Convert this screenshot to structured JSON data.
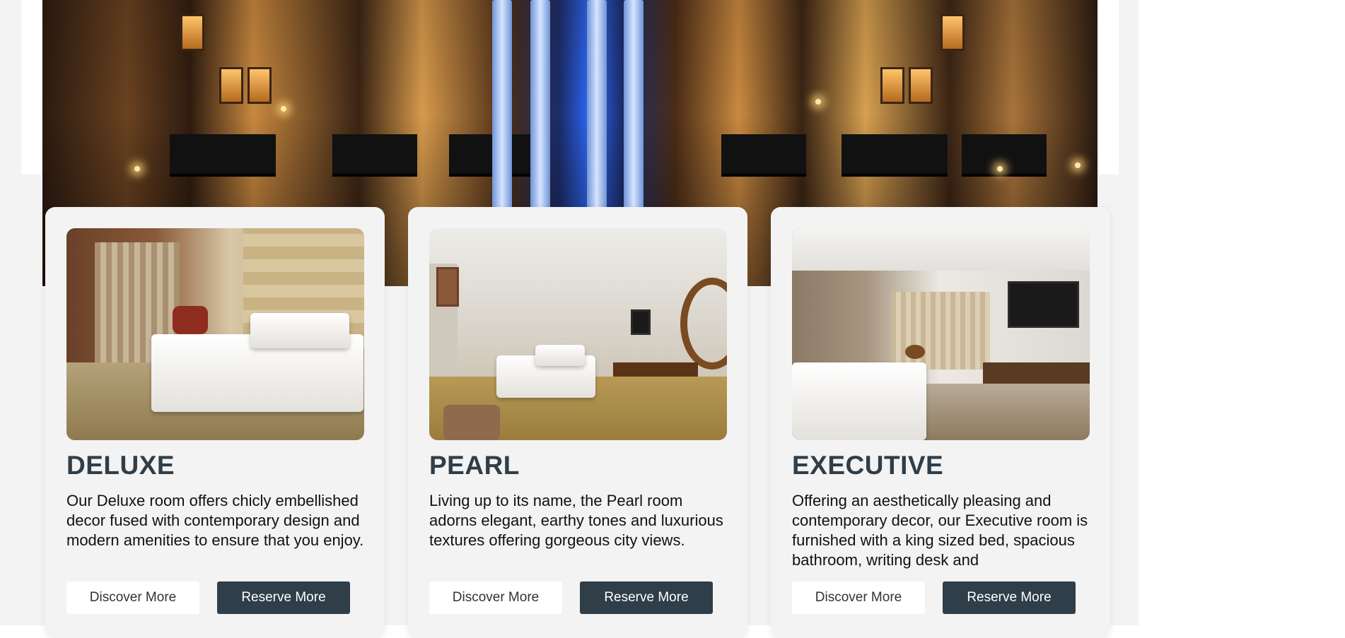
{
  "colors": {
    "page_background": "#f3f3f3",
    "card_background": "#f3f3f3",
    "heading": "#2f3e48",
    "primary_button": "#2f3e48",
    "secondary_button": "#ffffff"
  },
  "hero": {
    "image": "hotel-facade-night-photo"
  },
  "rooms": [
    {
      "name": "DELUXE",
      "image": "deluxe-room-photo",
      "description": "Our Deluxe room offers chicly embellished decor fused with contemporary design and modern amenities to ensure that you enjoy.",
      "discover_label": "Discover More",
      "reserve_label": "Reserve More"
    },
    {
      "name": "PEARL",
      "image": "pearl-room-photo",
      "description": "Living up to its name, the Pearl room adorns elegant, earthy tones and luxurious textures offering gorgeous city views.",
      "discover_label": "Discover More",
      "reserve_label": "Reserve More"
    },
    {
      "name": "EXECUTIVE",
      "image": "executive-room-photo",
      "description": "Offering an aesthetically pleasing and contemporary decor, our Executive room is furnished with a king sized bed, spacious bathroom, writing desk and",
      "discover_label": "Discover More",
      "reserve_label": "Reserve More"
    }
  ]
}
